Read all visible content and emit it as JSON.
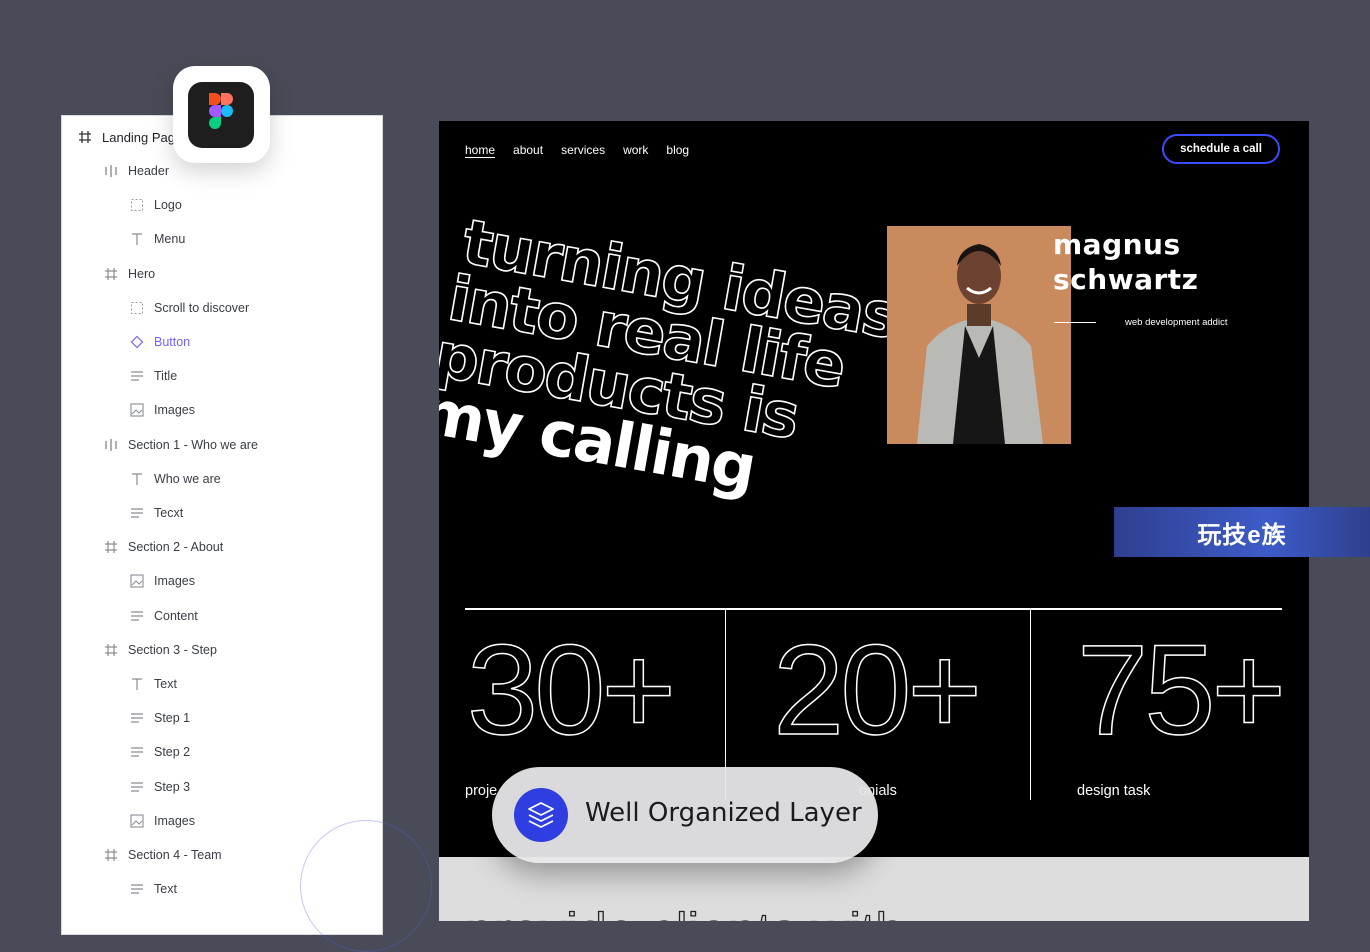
{
  "layers_panel": {
    "root": "Landing Pag",
    "items": [
      {
        "label": "Header",
        "icon": "vertical-autolayout-icon",
        "level": 1
      },
      {
        "label": "Logo",
        "icon": "dashed-frame-icon",
        "level": 2
      },
      {
        "label": "Menu",
        "icon": "text-icon",
        "level": 2
      },
      {
        "label": "Hero",
        "icon": "frame-icon",
        "level": 1
      },
      {
        "label": "Scroll to discover",
        "icon": "dashed-frame-icon",
        "level": 2
      },
      {
        "label": "Button",
        "icon": "component-icon",
        "level": 2,
        "accent": true
      },
      {
        "label": "Title",
        "icon": "paragraph-icon",
        "level": 2
      },
      {
        "label": "Images",
        "icon": "image-icon",
        "level": 2
      },
      {
        "label": "Section 1 - Who we are",
        "icon": "vertical-autolayout-icon",
        "level": 1
      },
      {
        "label": "Who we are",
        "icon": "text-icon",
        "level": 2
      },
      {
        "label": "Tecxt",
        "icon": "paragraph-icon",
        "level": 2
      },
      {
        "label": "Section 2 - About",
        "icon": "frame-icon",
        "level": 1
      },
      {
        "label": "Images",
        "icon": "image-icon",
        "level": 2
      },
      {
        "label": "Content",
        "icon": "paragraph-icon",
        "level": 2
      },
      {
        "label": "Section 3 - Step",
        "icon": "frame-icon",
        "level": 1
      },
      {
        "label": "Text",
        "icon": "text-icon",
        "level": 2
      },
      {
        "label": "Step 1",
        "icon": "paragraph-icon",
        "level": 2
      },
      {
        "label": "Step 2",
        "icon": "paragraph-icon",
        "level": 2
      },
      {
        "label": "Step 3",
        "icon": "paragraph-icon",
        "level": 2
      },
      {
        "label": "Images",
        "icon": "image-icon",
        "level": 2
      },
      {
        "label": "Section 4 - Team",
        "icon": "frame-icon",
        "level": 1
      },
      {
        "label": "Text",
        "icon": "paragraph-icon",
        "level": 2
      }
    ]
  },
  "app_icon": "figma-icon",
  "site": {
    "nav": [
      "home",
      "about",
      "services",
      "work",
      "blog"
    ],
    "cta": "schedule a call",
    "hero_lines": [
      "turning ideas",
      "into real life",
      "products is",
      "my calling"
    ],
    "person": {
      "first": "magnus",
      "last": "schwartz",
      "tagline": "web development addict"
    },
    "stats": [
      {
        "value": "30+",
        "label": "proje"
      },
      {
        "value": "20+",
        "label": "onials"
      },
      {
        "value": "75+",
        "label": "design task"
      }
    ],
    "next_section_text": "provide clients with"
  },
  "watermark": "玩技e族",
  "pill": {
    "label": "Well Organized Layer",
    "icon": "layers-icon"
  },
  "colors": {
    "accent": "#3b4bff",
    "panel_accent": "#7b61ff",
    "backdrop": "#494c58",
    "portrait_bg": "#c98a5e"
  }
}
